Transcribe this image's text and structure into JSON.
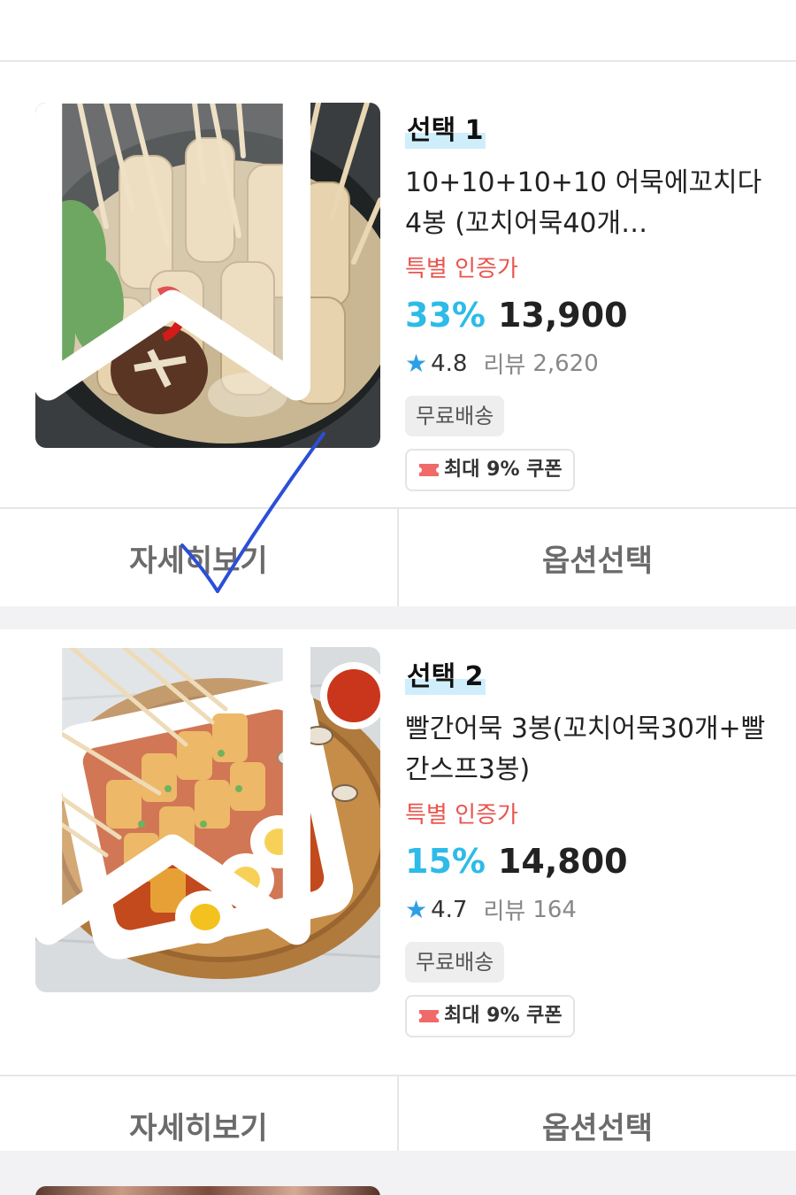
{
  "products": [
    {
      "option_label": "선택 1",
      "title": "10+10+10+10 어묵에꼬치다 4봉 (꼬치어묵40개…",
      "special_label": "특별 인증가",
      "discount": "33%",
      "price": "13,900",
      "rating": "4.8",
      "review_label": "리뷰",
      "review_count": "2,620",
      "shipping_badge": "무료배송",
      "coupon": "최대 9% 쿠폰",
      "detail_button": "자세히보기",
      "option_button": "옵션선택"
    },
    {
      "option_label": "선택 2",
      "title": "빨간어묵 3봉(꼬치어묵30개+빨간스프3봉)",
      "special_label": "특별 인증가",
      "discount": "15%",
      "price": "14,800",
      "rating": "4.7",
      "review_label": "리뷰",
      "review_count": "164",
      "shipping_badge": "무료배송",
      "coupon": "최대 9% 쿠폰",
      "detail_button": "자세히보기",
      "option_button": "옵션선택"
    }
  ],
  "colors": {
    "accent_discount": "#2dbbe8",
    "special_label": "#e8554e",
    "annotation_arrow": "#2c4fd6"
  },
  "icons": [
    "bookmark-icon",
    "star-icon",
    "coupon-icon"
  ]
}
